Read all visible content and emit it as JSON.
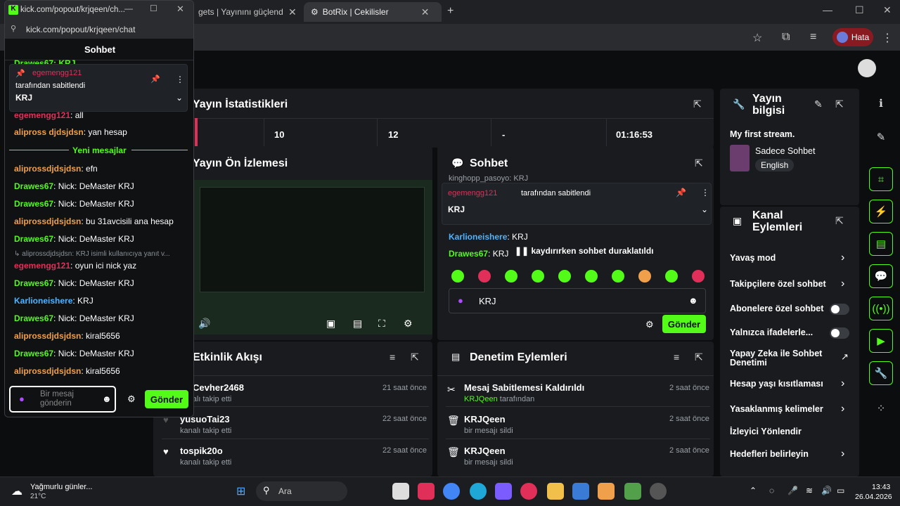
{
  "popout": {
    "url": "kick.com/popout/krjqeen/ch...",
    "address": "kick.com/popout/krjqeen/chat",
    "title": "Sohbet",
    "pinned_top_partial": "Drawes67: KRJ",
    "pinned": {
      "user": "egemengg121",
      "by": "tarafından sabitlendi",
      "msg": "KRJ"
    },
    "partial_msg": {
      "user": "egemengg121",
      "text": ": all"
    },
    "messages_before": [
      {
        "user": "alipross djdsjdsn",
        "text": ": yan hesap"
      }
    ],
    "new_divider": "Yeni mesajlar",
    "messages": [
      {
        "user": "aliprossdjdsjdsn",
        "text": ": efn"
      },
      {
        "user": "Drawes67",
        "text": ": Nick: DeMaster KRJ"
      },
      {
        "user": "Drawes67",
        "text": ": Nick: DeMaster KRJ"
      },
      {
        "user": "aliprossdjdsjdsn",
        "text": ": bu 31avcisili ana hesap"
      },
      {
        "user": "Drawes67",
        "text": ": Nick: DeMaster KRJ"
      },
      {
        "user": "aliprossdjdsjdsn",
        "text": ": KRJ isimli kullanıcıya yanıt v..."
      },
      {
        "user": "egemengg121",
        "text": ": oyun ici nick yaz"
      },
      {
        "user": "Drawes67",
        "text": ": Nick: DeMaster KRJ"
      },
      {
        "user": "Karlioneishere",
        "text": ": KRJ"
      },
      {
        "user": "Drawes67",
        "text": ": Nick: DeMaster KRJ"
      },
      {
        "user": "aliprossdjdsjdsn",
        "text": ": kiral5656"
      },
      {
        "user": "Drawes67",
        "text": ": Nick: DeMaster KRJ"
      },
      {
        "user": "aliprossdjdsjdsn",
        "text": ": kiral5656"
      }
    ],
    "input_placeholder": "Bir mesaj gönderin",
    "send": "Gönder"
  },
  "tabs": [
    {
      "label": "gets | Yayınını güçlendirme"
    },
    {
      "label": "BotRix | Cekilisler"
    }
  ],
  "toolbar": {
    "error_label": "Hata"
  },
  "stats": {
    "title": "Yayın İstatistikleri",
    "values": [
      "10",
      "12",
      "-",
      "01:16:53"
    ]
  },
  "preview": {
    "title": "Yayın Ön İzlemesi"
  },
  "chat_panel": {
    "title": "Sohbet",
    "top_partial": "kinghopp_pasoyo: KRJ",
    "pinned_user": "egemengg121",
    "pinned_by": "tarafından sabitlendi",
    "pinned_msg": "KRJ",
    "msg1_user": "Karlioneishere",
    "msg1_text": ": KRJ",
    "msg2_user": "Drawes67",
    "msg2_text": ": KRJ",
    "paused": "kaydırırken sohbet duraklatıldı",
    "input_value": "KRJ",
    "send": "Gönder"
  },
  "stream_info": {
    "title": "Yayın bilgisi",
    "stream_name": "My first stream.",
    "category": "Sadece Sohbet",
    "language": "English"
  },
  "channel_actions": {
    "title": "Kanal Eylemleri",
    "items": [
      "Yavaş mod",
      "Takipçilere özel sohbet",
      "Abonelere özel sohbet",
      "Yalnızca ifadelerle...",
      "Yapay Zeka ile Sohbet Denetimi",
      "Hesap yaşı kısıtlaması",
      "Yasaklanmış kelimeler",
      "İzleyici Yönlendir",
      "Hedefleri belirleyin"
    ]
  },
  "activity": {
    "title": "Etkinlik Akışı",
    "items": [
      {
        "name": "Cevher2468",
        "sub": "kanalı takip etti",
        "time": "21 saat önce"
      },
      {
        "name": "yusuoTai23",
        "sub": "kanalı takip etti",
        "time": "22 saat önce"
      },
      {
        "name": "tospik20o",
        "sub": "kanalı takip etti",
        "time": "22 saat önce"
      }
    ]
  },
  "moderation": {
    "title": "Denetim Eylemleri",
    "items": [
      {
        "name": "Mesaj Sabitlemesi Kaldırıldı",
        "by": "KRJQeen",
        "sub": "tarafından",
        "time": "2 saat önce"
      },
      {
        "name": "KRJQeen",
        "sub": "bir mesajı sildi",
        "time": "2 saat önce"
      },
      {
        "name": "KRJQeen",
        "sub": "bir mesajı sildi",
        "time": "2 saat önce"
      }
    ]
  },
  "taskbar": {
    "weather": "Yağmurlu günler...",
    "temp": "21°C",
    "search": "Ara",
    "time": "13:43",
    "date": "26.04.2026"
  }
}
